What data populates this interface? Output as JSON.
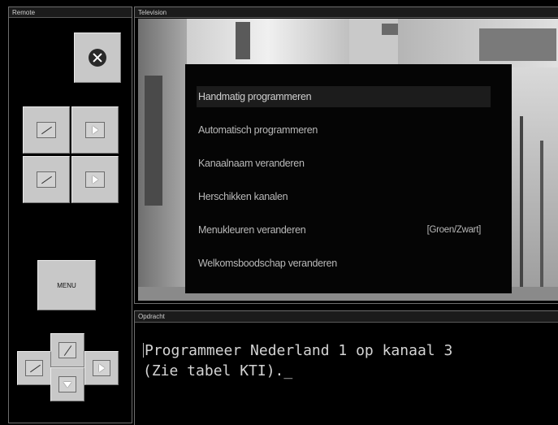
{
  "remote": {
    "title": "Remote",
    "menu_label": "MENU"
  },
  "television": {
    "title": "Television",
    "menu": {
      "items": [
        {
          "label": "Handmatig programmeren",
          "value": "",
          "active": true
        },
        {
          "label": "Automatisch programmeren",
          "value": ""
        },
        {
          "label": "Kanaalnaam veranderen",
          "value": ""
        },
        {
          "label": "Herschikken kanalen",
          "value": ""
        },
        {
          "label": "Menukleuren veranderen",
          "value": "[Groen/Zwart]"
        },
        {
          "label": "Welkomsboodschap veranderen",
          "value": ""
        }
      ]
    }
  },
  "output": {
    "title": "Opdracht",
    "line1": "Programmeer Nederland 1 op kanaal 3",
    "line2": "(Zie tabel KTI)._"
  },
  "icons": [
    "close-icon",
    "slash-icon",
    "play-triangle-icon",
    "triangle-down-icon"
  ],
  "colors": {
    "background": "#000000",
    "button": "#c8c8c8",
    "osd_background": "#050505",
    "osd_text": "#b9b9b9",
    "output_text": "#d4d4d4"
  }
}
